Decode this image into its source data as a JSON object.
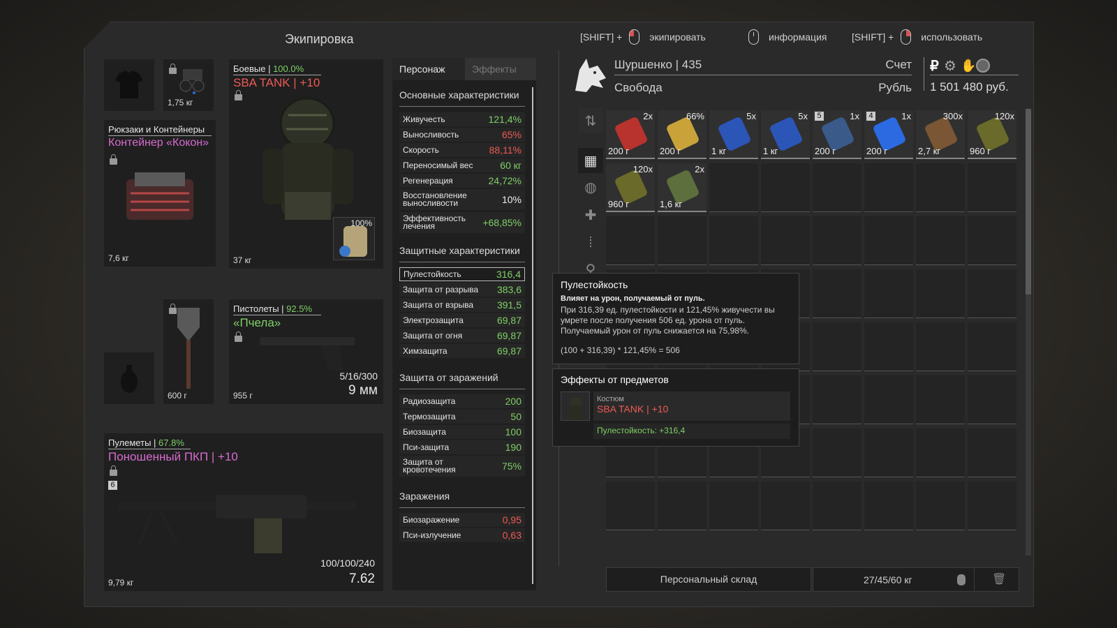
{
  "header": {
    "title": "Экипировка",
    "hints": [
      {
        "prefix": "[SHIFT] +",
        "label": "экипировать"
      },
      {
        "prefix": "",
        "label": "информация"
      },
      {
        "prefix": "[SHIFT] +",
        "label": "использовать"
      }
    ]
  },
  "slots": {
    "undershirt_weight": "",
    "device_weight": "1,75 кг",
    "armor": {
      "category": "Боевые | ",
      "durability": "100.0%",
      "name": "SBA TANK | +10",
      "weight": "37 кг",
      "container_charge": "100%"
    },
    "backpack": {
      "category": "Рюкзаки и Контейнеры",
      "name": "Контейнер «Кокон»",
      "weight": "7,6 кг"
    },
    "melee_weight": "600 г",
    "pistol": {
      "category": "Пистолеты | ",
      "durability": "92.5%",
      "name": "«Пчела»",
      "weight": "955 г",
      "ammo": "5/16/300",
      "caliber": "9 мм"
    },
    "mg": {
      "category": "Пулеметы | ",
      "durability": "67.8%",
      "name": "Поношенный ПКП | +10",
      "upgrade": "6",
      "weight": "9,79 кг",
      "ammo": "100/100/240",
      "caliber": "7.62"
    }
  },
  "stats": {
    "tabs": [
      "Персонаж",
      "Эффекты"
    ],
    "sections": {
      "basic": "Основные характеристики",
      "protective": "Защитные характеристики",
      "infection": "Защита от заражений",
      "contam": "Заражения"
    },
    "basic": [
      {
        "label": "Живучесть",
        "value": "121,4%",
        "color": "#7fd067"
      },
      {
        "label": "Выносливость",
        "value": "65%",
        "color": "#ee5a55"
      },
      {
        "label": "Скорость",
        "value": "88,11%",
        "color": "#ee5a55"
      },
      {
        "label": "Переносимый вес",
        "value": "60 кг",
        "color": "#7fd067"
      },
      {
        "label": "Регенерация",
        "value": "24,72%",
        "color": "#7fd067"
      },
      {
        "label": "Восстановление выносливости",
        "value": "10%",
        "color": "#eeeeee"
      },
      {
        "label": "Эффективность лечения",
        "value": "+68,85%",
        "color": "#7fd067"
      }
    ],
    "protective": [
      {
        "label": "Пулестойкость",
        "value": "316,4"
      },
      {
        "label": "Защита от разрыва",
        "value": "383,6"
      },
      {
        "label": "Защита от взрыва",
        "value": "391,5"
      },
      {
        "label": "Электрозащита",
        "value": "69,87"
      },
      {
        "label": "Защита от огня",
        "value": "69,87"
      },
      {
        "label": "Химзащита",
        "value": "69,87"
      }
    ],
    "infection": [
      {
        "label": "Радиозащита",
        "value": "200"
      },
      {
        "label": "Термозащита",
        "value": "50"
      },
      {
        "label": "Биозащита",
        "value": "100"
      },
      {
        "label": "Пси-защита",
        "value": "190"
      },
      {
        "label": "Защита от кровотечения",
        "value": "75%"
      }
    ],
    "contam": [
      {
        "label": "Биозаражение",
        "value": "0,95"
      },
      {
        "label": "Пси-излучение",
        "value": "0,63"
      }
    ]
  },
  "player": {
    "name": "Шуршенко",
    "sep": " | ",
    "level": "435",
    "faction": "Свобода",
    "account_label": "Счет",
    "currency_label": "Рубль",
    "balance": "1 501 480 руб."
  },
  "inventory": {
    "items": [
      {
        "qty": "2x",
        "weight": "200 г",
        "color": "#b8332e"
      },
      {
        "qty": "66%",
        "weight": "200 г",
        "color": "#c9a33a"
      },
      {
        "qty": "5x",
        "weight": "1 кг",
        "color": "#2c55b8"
      },
      {
        "qty": "5x",
        "weight": "1 кг",
        "color": "#2c55b8"
      },
      {
        "qty": "1x",
        "weight": "200 г",
        "color": "#3a5a8a",
        "badge": "5"
      },
      {
        "qty": "1x",
        "weight": "200 г",
        "color": "#2b6ae0",
        "badge": "4"
      },
      {
        "qty": "300x",
        "weight": "2,7 кг",
        "color": "#7a5634"
      },
      {
        "qty": "120x",
        "weight": "960 г",
        "color": "#6a6a2a"
      },
      {
        "qty": "120x",
        "weight": "960 г",
        "color": "#6a6a2a"
      },
      {
        "qty": "2x",
        "weight": "1,6 кг",
        "color": "#5d6f3c"
      }
    ],
    "storage_label": "Персональный склад",
    "weight": "27/45/60 кг"
  },
  "tooltip": {
    "title": "Пулестойкость",
    "bold": "Влияет на урон, получаемый от пуль.",
    "text1": "При 316,39 ед. пулестойкости и 121,45% живучести вы умрете после получения 506 ед. урона от пуль.",
    "text2": "Получаемый урон от пуль снижается на 75,98%.",
    "formula": "(100 + 316,39) * 121,45% = 506",
    "effects_title": "Эффекты от предметов",
    "eff_type": "Костюм",
    "eff_name": "SBA TANK | +10",
    "eff_value": "Пулестойкость: +316,4"
  }
}
